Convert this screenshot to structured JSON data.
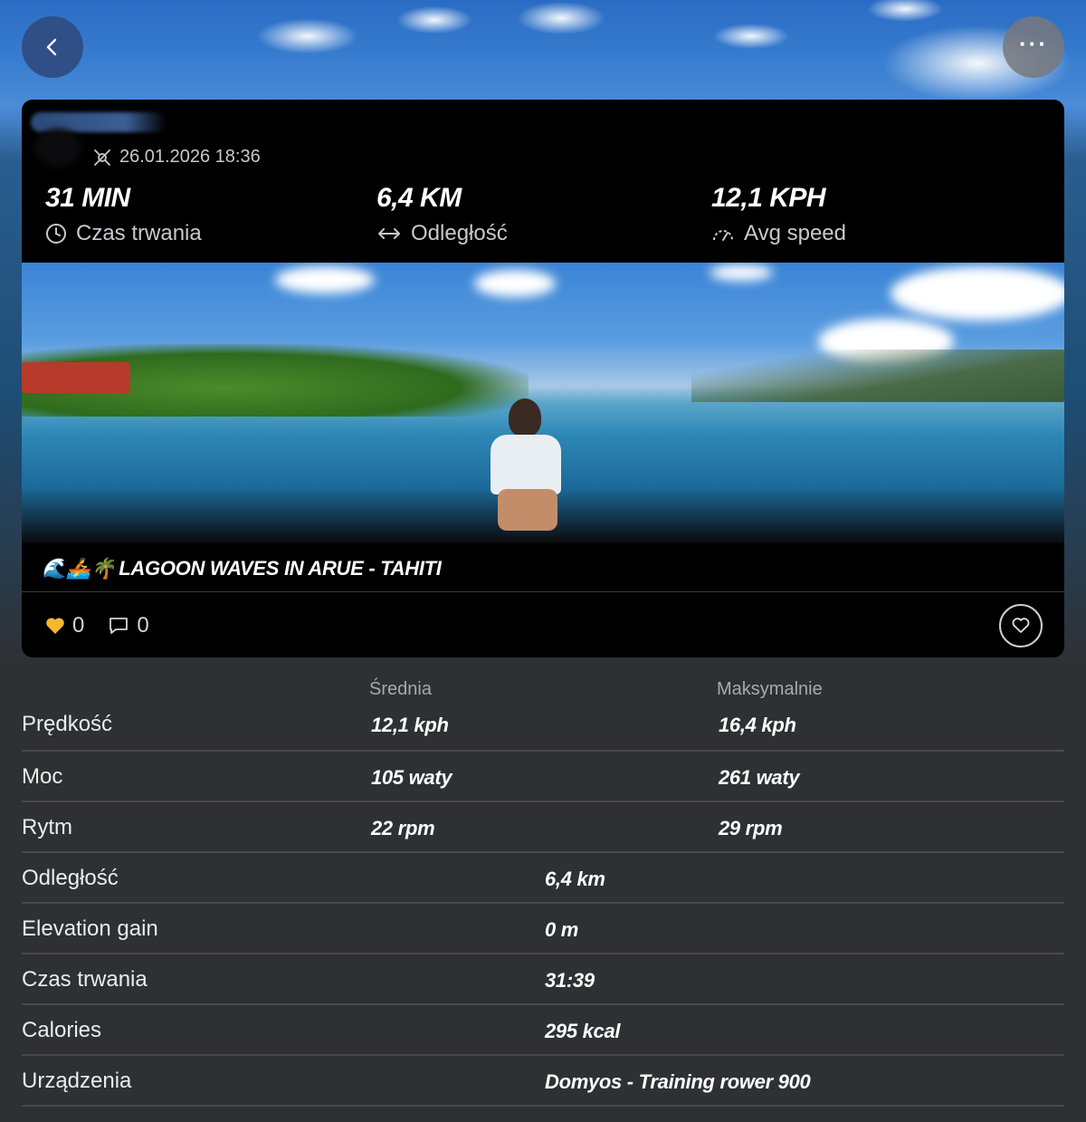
{
  "header": {
    "back_icon": "chevron-left-icon",
    "more_icon": "ellipsis-icon",
    "more_label": "···"
  },
  "activity": {
    "sport_icon": "rowing-icon",
    "datetime": "26.01.2026 18:36",
    "stats": [
      {
        "value": "31 MIN",
        "label": "Czas trwania",
        "icon": "clock-icon"
      },
      {
        "value": "6,4 KM",
        "label": "Odległość",
        "icon": "arrows-horizontal-icon"
      },
      {
        "value": "12,1 KPH",
        "label": "Avg speed",
        "icon": "speedometer-icon"
      }
    ],
    "title_emoji": "🌊🚣🌴",
    "title": "LAGOON WAVES IN ARUE - TAHITI",
    "likes": "0",
    "comments": "0",
    "colors": {
      "like": "#f5b731",
      "back_button": "#2f4f86"
    }
  },
  "details": {
    "col_avg": "Średnia",
    "col_max": "Maksymalnie",
    "paired_rows": [
      {
        "label": "Prędkość",
        "avg": "12,1 kph",
        "max": "16,4 kph"
      },
      {
        "label": "Moc",
        "avg": "105 waty",
        "max": "261 waty"
      },
      {
        "label": "Rytm",
        "avg": "22 rpm",
        "max": "29 rpm"
      }
    ],
    "single_rows": [
      {
        "label": "Odległość",
        "value": "6,4 km"
      },
      {
        "label": "Elevation gain",
        "value": "0 m"
      },
      {
        "label": "Czas trwania",
        "value": "31:39"
      },
      {
        "label": "Calories",
        "value": "295 kcal"
      },
      {
        "label": "Urządzenia",
        "value": "Domyos - Training rower 900"
      }
    ]
  }
}
